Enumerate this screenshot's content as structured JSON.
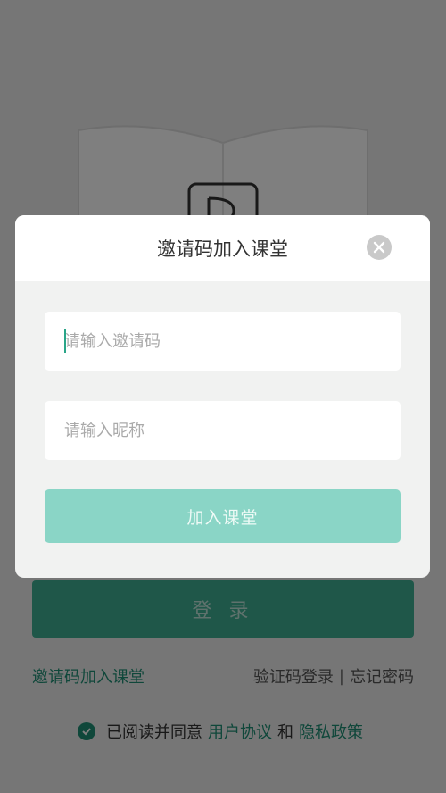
{
  "background": {
    "login_button_label": "登 录",
    "invite_link": "邀请码加入课堂",
    "sms_login_link": "验证码登录",
    "separator": "|",
    "forgot_password_link": "忘记密码",
    "agreement": {
      "prefix": "已阅读并同意",
      "user_agreement": "用户协议",
      "and": "和",
      "privacy_policy": "隐私政策"
    }
  },
  "dialog": {
    "title": "邀请码加入课堂",
    "invite_code_placeholder": "请输入邀请码",
    "invite_code_value": "",
    "nickname_placeholder": "请输入昵称",
    "nickname_value": "",
    "join_button_label": "加入课堂"
  },
  "colors": {
    "accent": "#1f8f75",
    "join_button": "#8ad5c6",
    "login_button": "#3fae93"
  },
  "icons": {
    "close": "close-icon",
    "check": "check-circle-icon",
    "logo": "book-logo-icon"
  }
}
